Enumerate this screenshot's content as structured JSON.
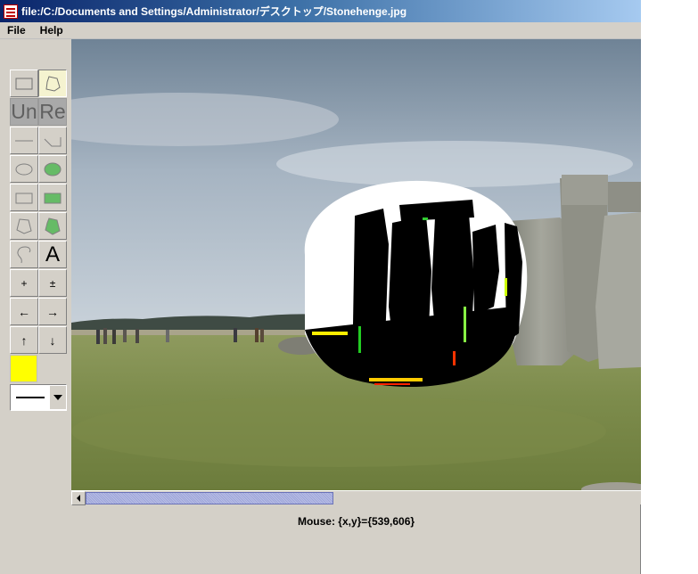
{
  "window": {
    "title": "file:/C:/Documents and Settings/Administrator/デスクトップ/Stonehenge.jpg"
  },
  "menu": {
    "items": [
      "File",
      "Help"
    ]
  },
  "toolbar": {
    "undo_label": "Un",
    "redo_label": "Re",
    "text_tool_label": "A",
    "zoom_in_label": "+",
    "zoom_out_label": "±",
    "arrow_left": "←",
    "arrow_right": "→",
    "arrow_up": "↑",
    "arrow_down": "↓",
    "selected_tool": "polygon-select",
    "current_color": "#ffff00"
  },
  "status": {
    "mouse_text": "Mouse: {x,y}={539,606}"
  },
  "colors": {
    "title_gradient_start": "#0a246a",
    "title_gradient_end": "#a6caf0",
    "window_bg": "#d4d0c8",
    "selected_tool_bg": "#f5f3d0",
    "scroll_thumb": "#9ea6d8",
    "shape_fill": "#66bb66"
  }
}
